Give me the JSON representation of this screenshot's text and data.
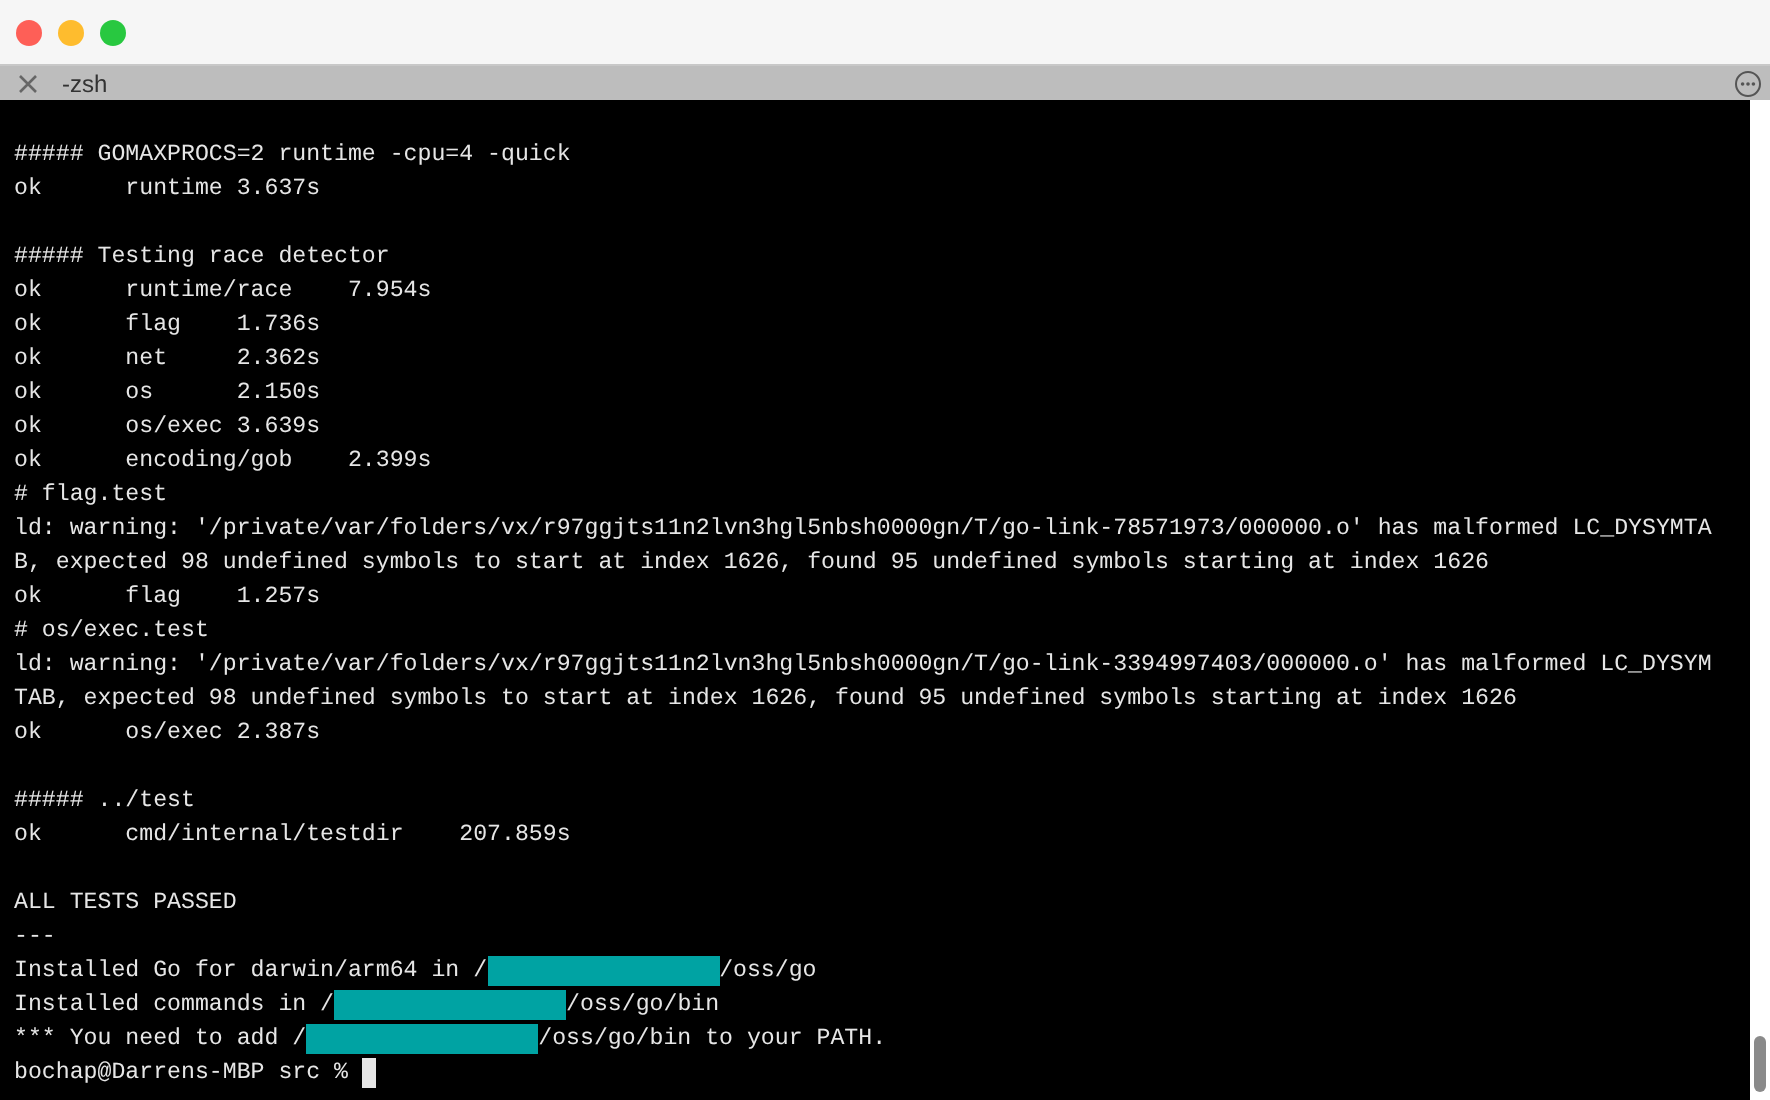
{
  "window": {
    "tab_title": "-zsh"
  },
  "terminal": {
    "lines": [
      {
        "kind": "text",
        "text": "##### GOMAXPROCS=2 runtime -cpu=4 -quick"
      },
      {
        "kind": "text",
        "text": "ok      runtime 3.637s"
      },
      {
        "kind": "blank"
      },
      {
        "kind": "text",
        "text": "##### Testing race detector"
      },
      {
        "kind": "text",
        "text": "ok      runtime/race    7.954s"
      },
      {
        "kind": "text",
        "text": "ok      flag    1.736s"
      },
      {
        "kind": "text",
        "text": "ok      net     2.362s"
      },
      {
        "kind": "text",
        "text": "ok      os      2.150s"
      },
      {
        "kind": "text",
        "text": "ok      os/exec 3.639s"
      },
      {
        "kind": "text",
        "text": "ok      encoding/gob    2.399s"
      },
      {
        "kind": "text",
        "text": "# flag.test"
      },
      {
        "kind": "text",
        "text": "ld: warning: '/private/var/folders/vx/r97ggjts11n2lvn3hgl5nbsh0000gn/T/go-link-78571973/000000.o' has malformed LC_DYSYMTA"
      },
      {
        "kind": "text",
        "text": "B, expected 98 undefined symbols to start at index 1626, found 95 undefined symbols starting at index 1626"
      },
      {
        "kind": "text",
        "text": "ok      flag    1.257s"
      },
      {
        "kind": "text",
        "text": "# os/exec.test"
      },
      {
        "kind": "text",
        "text": "ld: warning: '/private/var/folders/vx/r97ggjts11n2lvn3hgl5nbsh0000gn/T/go-link-3394997403/000000.o' has malformed LC_DYSYM"
      },
      {
        "kind": "text",
        "text": "TAB, expected 98 undefined symbols to start at index 1626, found 95 undefined symbols starting at index 1626"
      },
      {
        "kind": "text",
        "text": "ok      os/exec 2.387s"
      },
      {
        "kind": "blank"
      },
      {
        "kind": "text",
        "text": "##### ../test"
      },
      {
        "kind": "text",
        "text": "ok      cmd/internal/testdir    207.859s"
      },
      {
        "kind": "blank"
      },
      {
        "kind": "text",
        "text": "ALL TESTS PASSED"
      },
      {
        "kind": "text",
        "text": "---"
      },
      {
        "kind": "redacted",
        "before": "Installed Go for darwin/arm64 in /",
        "after": "/oss/go"
      },
      {
        "kind": "redacted",
        "before": "Installed commands in /",
        "after": "/oss/go/bin"
      },
      {
        "kind": "redacted",
        "before": "*** You need to add /",
        "after": "/oss/go/bin to your PATH."
      },
      {
        "kind": "prompt",
        "text": "bochap@Darrens-MBP src % "
      }
    ]
  }
}
